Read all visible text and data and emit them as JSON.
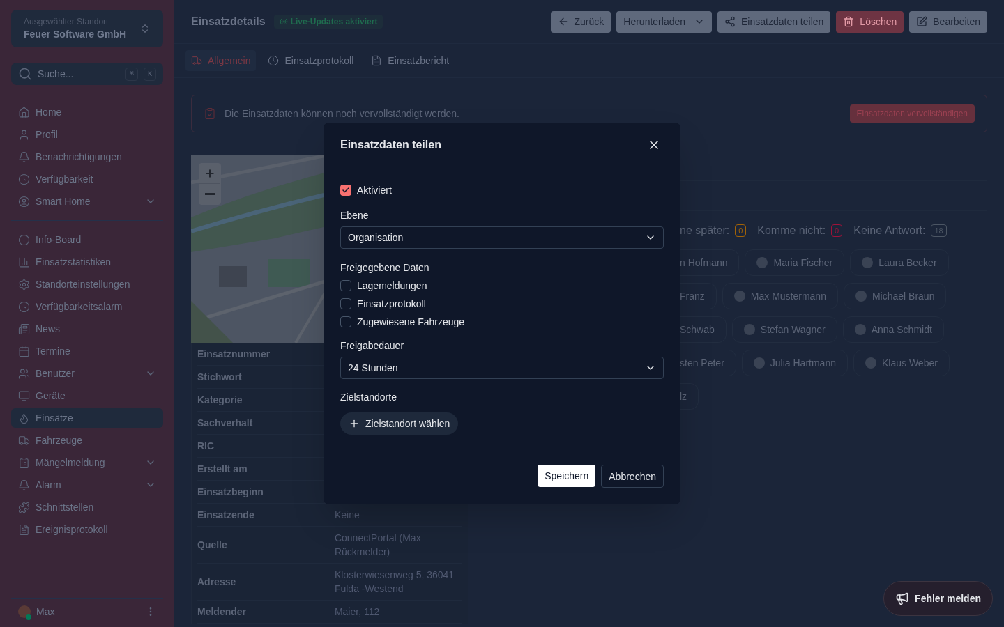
{
  "sidebar": {
    "location": {
      "label": "Ausgewählter Standort",
      "value": "Feuer Software GmbH"
    },
    "search": {
      "placeholder": "Suche...",
      "keys": [
        "⌘",
        "K"
      ]
    },
    "groups": [
      [
        {
          "label": "Home",
          "selected": false,
          "has_submenu": false
        },
        {
          "label": "Profil",
          "selected": false,
          "has_submenu": false
        },
        {
          "label": "Benachrichtigungen",
          "selected": false,
          "has_submenu": false
        },
        {
          "label": "Verfügbarkeit",
          "selected": false,
          "has_submenu": false
        },
        {
          "label": "Smart Home",
          "selected": false,
          "has_submenu": true
        }
      ],
      [
        {
          "label": "Info-Board",
          "selected": false,
          "has_submenu": false
        },
        {
          "label": "Einsatzstatistiken",
          "selected": false,
          "has_submenu": false
        },
        {
          "label": "Standorteinstellungen",
          "selected": false,
          "has_submenu": false
        },
        {
          "label": "Verfügbarkeitsalarm",
          "selected": false,
          "has_submenu": false
        },
        {
          "label": "News",
          "selected": false,
          "has_submenu": false
        },
        {
          "label": "Termine",
          "selected": false,
          "has_submenu": false
        },
        {
          "label": "Benutzer",
          "selected": false,
          "has_submenu": true
        },
        {
          "label": "Geräte",
          "selected": false,
          "has_submenu": false
        },
        {
          "label": "Einsätze",
          "selected": true,
          "has_submenu": false
        },
        {
          "label": "Fahrzeuge",
          "selected": false,
          "has_submenu": false
        },
        {
          "label": "Mängelmeldung",
          "selected": false,
          "has_submenu": true
        },
        {
          "label": "Alarm",
          "selected": false,
          "has_submenu": true
        },
        {
          "label": "Schnittstellen",
          "selected": false,
          "has_submenu": false
        },
        {
          "label": "Ereignisprotokoll",
          "selected": false,
          "has_submenu": false
        }
      ]
    ],
    "user": {
      "name": "Max",
      "online": true
    }
  },
  "header": {
    "title": "Einsatzdetails",
    "badge": "Live-Updates aktiviert",
    "buttons": [
      {
        "label": "Zurück",
        "kind": "back"
      },
      {
        "label": "Herunterladen",
        "kind": "dropdown"
      },
      {
        "label": "Einsatzdaten teilen",
        "kind": "share"
      },
      {
        "label": "Löschen",
        "kind": "delete"
      },
      {
        "label": "Bearbeiten",
        "kind": "edit"
      }
    ]
  },
  "tabs": [
    {
      "label": "Allgemein",
      "selected": true
    },
    {
      "label": "Einsatzprotokoll",
      "selected": false
    },
    {
      "label": "Einsatzbericht",
      "selected": false
    }
  ],
  "alert": {
    "text": "Die Einsatzdaten können noch vervollständigt werden.",
    "button": "Einsatzdaten vervollständigen"
  },
  "details": [
    {
      "label": "Einsatznummer"
    },
    {
      "label": "Stichwort"
    },
    {
      "label": "Kategorie"
    },
    {
      "label": "Sachverhalt"
    },
    {
      "label": "RIC"
    },
    {
      "label": "Erstellt am"
    },
    {
      "label": "Einsatzbeginn"
    },
    {
      "label": "Einsatzende",
      "value": "Keine"
    },
    {
      "label": "Quelle",
      "value": "ConnectPortal (Max Rückmelder)"
    },
    {
      "label": "Adresse",
      "value": "Klosterwiesenweg 5, 36041 Fulda -Westend"
    },
    {
      "label": "Meldender",
      "value": "Maier, 112"
    }
  ],
  "responses": {
    "counts": [
      {
        "label": "ne später:",
        "value": "0",
        "color": "#a16207"
      },
      {
        "label": "Komme nicht:",
        "value": "0",
        "color": "#9f1239"
      },
      {
        "label": "Keine Antwort:",
        "value": "18",
        "color": "#4b5563"
      }
    ],
    "rows": [
      [
        "n Hofmann",
        "Maria Fischer",
        "Laura Becker"
      ],
      [
        "Franz",
        "Max Mustermann",
        "Michael Braun"
      ],
      [
        "Schwab",
        "Stefan Wagner",
        "Anna Schmidt"
      ],
      [
        "sten Peter",
        "Julia Hartmann",
        "Klaus Weber"
      ],
      [
        "lz"
      ]
    ]
  },
  "dialog": {
    "title": "Einsatzdaten teilen",
    "enabled": {
      "label": "Aktiviert",
      "checked": true
    },
    "level": {
      "label": "Ebene",
      "value": "Organisation"
    },
    "shared": {
      "label": "Freigegebene Daten",
      "options": [
        {
          "label": "Lagemeldungen",
          "checked": false
        },
        {
          "label": "Einsatzprotokoll",
          "checked": false
        },
        {
          "label": "Zugewiesene Fahrzeuge",
          "checked": false
        }
      ]
    },
    "duration": {
      "label": "Freigabedauer",
      "value": "24 Stunden"
    },
    "targets": {
      "label": "Zielstandorte",
      "button": "Zielstandort wählen"
    },
    "save": "Speichern",
    "cancel": "Abbrechen"
  },
  "report_button": "Fehler melden"
}
